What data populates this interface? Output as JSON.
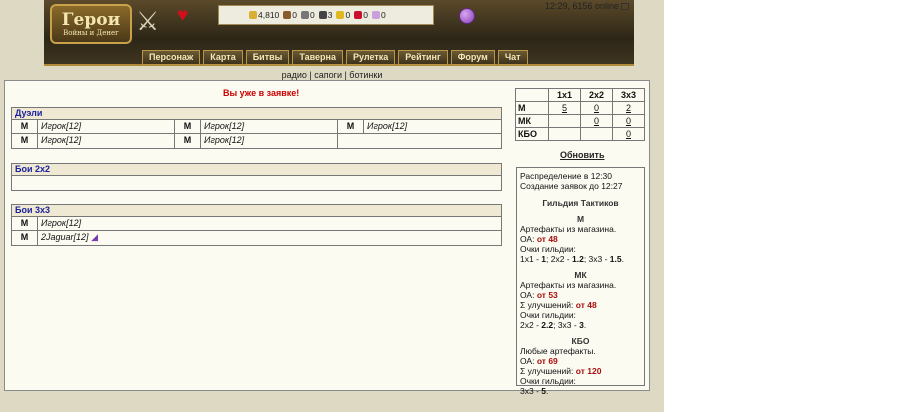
{
  "header": {
    "logo_title": "Герои",
    "logo_subtitle": "Войны и Денег",
    "resources": [
      {
        "value": "4,810",
        "color": "#d9b034"
      },
      {
        "value": "0",
        "color": "#8b5a2b"
      },
      {
        "value": "0",
        "color": "#777777"
      },
      {
        "value": "3",
        "color": "#444444"
      },
      {
        "value": "0",
        "color": "#e0b820"
      },
      {
        "value": "0",
        "color": "#c8102e"
      },
      {
        "value": "0",
        "color": "#c9a0dc"
      }
    ],
    "time_online": "12:29, 6156 online"
  },
  "nav": [
    "Персонаж",
    "Карта",
    "Битвы",
    "Таверна",
    "Рулетка",
    "Рейтинг",
    "Форум",
    "Чат"
  ],
  "sublinks": "радио | сапоги | ботинки",
  "status_message": "Вы уже в заявке!",
  "duels": {
    "title": "Дуэли",
    "rows": [
      [
        {
          "m": "M",
          "name": "Игрок[12]"
        },
        {
          "m": "M",
          "name": "Игрок[12]"
        },
        {
          "m": "M",
          "name": "Игрок[12]"
        }
      ],
      [
        {
          "m": "M",
          "name": "Игрок[12]"
        },
        {
          "m": "M",
          "name": "Игрок[12]"
        }
      ]
    ]
  },
  "battles2": {
    "title": "Бои 2x2"
  },
  "battles3": {
    "title": "Бои 3x3",
    "rows": [
      {
        "m": "M",
        "name": "Игрок[12]"
      },
      {
        "m": "M",
        "name": "2Jaguar[12]"
      }
    ]
  },
  "counts": {
    "headers": [
      "1x1",
      "2x2",
      "3x3"
    ],
    "rows": [
      {
        "label": "M",
        "values": [
          "5",
          "0",
          "2"
        ]
      },
      {
        "label": "МК",
        "values": [
          "",
          "0",
          "0"
        ]
      },
      {
        "label": "КБО",
        "values": [
          "",
          "",
          "0"
        ]
      }
    ]
  },
  "refresh_label": "Обновить",
  "info": {
    "line1": "Распределение в 12:30",
    "line2": "Создание заявок до 12:27",
    "guild_title": "Гильдия Тактиков",
    "m_title": "M",
    "m_desc": "Артефакты из магазина.",
    "m_oa_label": "ОА: ",
    "m_oa_value": "от 48",
    "m_points_label": "Очки гильдии:",
    "m_points_parts": [
      "1x1 - ",
      "1",
      "; 2x2 - ",
      "1.2",
      "; 3x3 - ",
      "1.5",
      "."
    ],
    "mk_title": "МК",
    "mk_desc": "Артефакты из магазина.",
    "mk_oa_label": "ОА: ",
    "mk_oa_value": "от 53",
    "mk_imp_label": "Σ улучшений: ",
    "mk_imp_value": "от 48",
    "mk_points_label": "Очки гильдии:",
    "mk_points_parts": [
      "2x2 - ",
      "2.2",
      "; 3x3 - ",
      "3",
      "."
    ],
    "kbo_title": "КБО",
    "kbo_desc": "Любые артефакты.",
    "kbo_oa_label": "ОА: ",
    "kbo_oa_value": "от 69",
    "kbo_imp_label": "Σ улучшений: ",
    "kbo_imp_value": "от 120",
    "kbo_points_label": "Очки гильдии:",
    "kbo_points_parts": [
      "3x3 - ",
      "5",
      "."
    ]
  }
}
